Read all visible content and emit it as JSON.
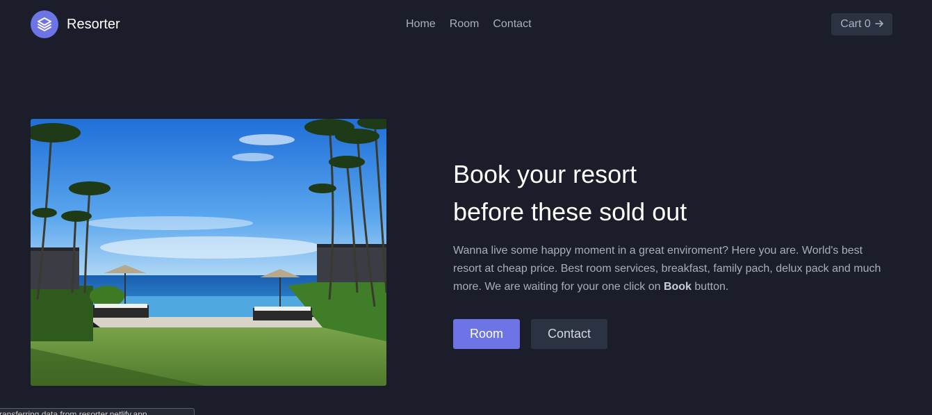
{
  "brand": {
    "name": "Resorter",
    "icon": "stack-layers-icon"
  },
  "nav": {
    "items": [
      "Home",
      "Room",
      "Contact"
    ]
  },
  "cart": {
    "label": "Cart 0",
    "icon": "arrow-right-icon"
  },
  "hero": {
    "title_line1": "Book your resort",
    "title_line2": "before these sold out",
    "desc_prefix": "Wanna live some happy moment in a great enviroment? Here you are. World's best resort at cheap price. Best room services, breakfast, family pach, delux pack and much more. We are waiting for your one click on ",
    "desc_bold": "Book",
    "desc_suffix": " button.",
    "primary_button": "Room",
    "secondary_button": "Contact"
  },
  "status_bar": {
    "text": "ransferring data from resorter.netlify.app..."
  },
  "colors": {
    "accent": "#6c74e6",
    "background": "#1b1e2a",
    "button_dark": "#2b3342"
  }
}
